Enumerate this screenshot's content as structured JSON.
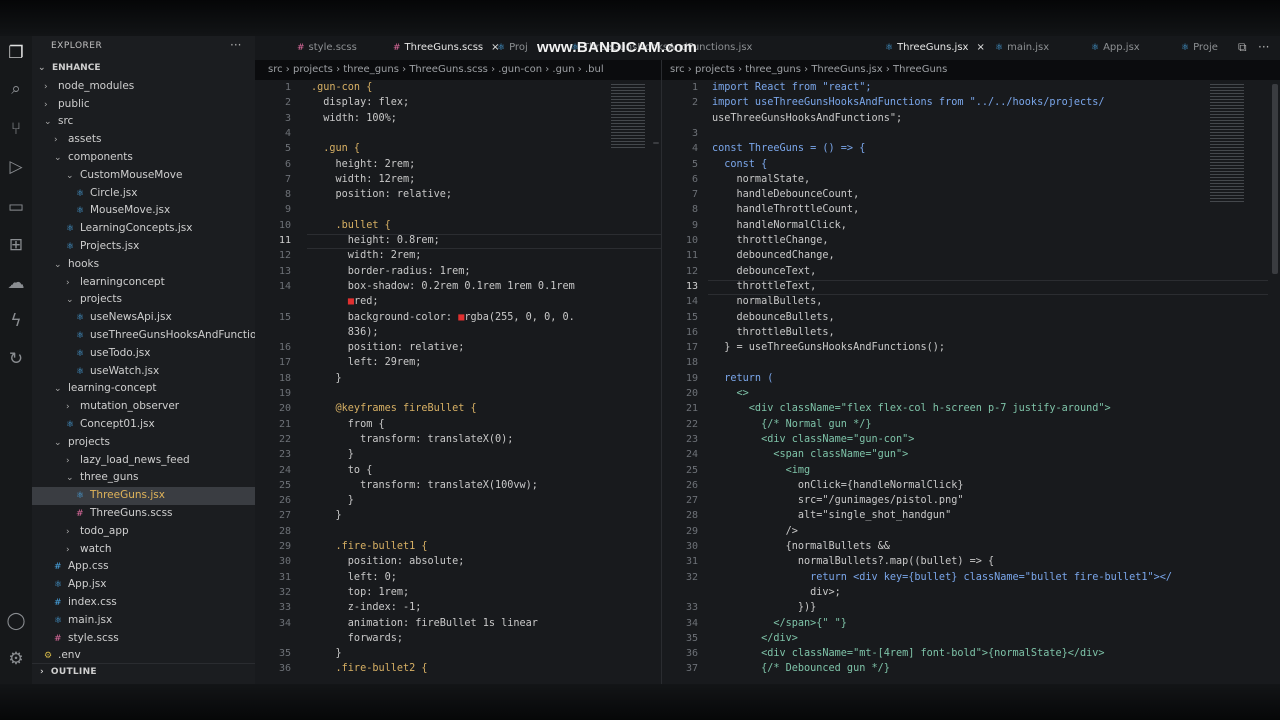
{
  "watermark": "www.BANDICAM.com",
  "activity_icons": [
    "files-icon",
    "search-icon",
    "source-control-icon",
    "run-debug-icon",
    "remote-explorer-icon",
    "extensions-icon",
    "docker-icon",
    "thunder-icon",
    "live-share-icon",
    "account-icon",
    "settings-gear-icon"
  ],
  "sidebar": {
    "title": "EXPLORER",
    "more": "···",
    "outline": "OUTLINE",
    "items": [
      {
        "label": "ENHANCE",
        "depth": 0,
        "type": "root",
        "chev": "v"
      },
      {
        "label": "node_modules",
        "depth": 1,
        "type": "folder",
        "chev": ">"
      },
      {
        "label": "public",
        "depth": 1,
        "type": "folder",
        "chev": ">"
      },
      {
        "label": "src",
        "depth": 1,
        "type": "folder",
        "chev": "v"
      },
      {
        "label": "assets",
        "depth": 2,
        "type": "folder",
        "chev": ">"
      },
      {
        "label": "components",
        "depth": 2,
        "type": "folder",
        "chev": "v"
      },
      {
        "label": "CustomMouseMove",
        "depth": 3,
        "type": "folder",
        "chev": "v"
      },
      {
        "label": "Circle.jsx",
        "depth": 4,
        "type": "js"
      },
      {
        "label": "MouseMove.jsx",
        "depth": 4,
        "type": "js"
      },
      {
        "label": "LearningConcepts.jsx",
        "depth": 3,
        "type": "js"
      },
      {
        "label": "Projects.jsx",
        "depth": 3,
        "type": "js"
      },
      {
        "label": "hooks",
        "depth": 2,
        "type": "folder",
        "chev": "v"
      },
      {
        "label": "learningconcept",
        "depth": 3,
        "type": "folder",
        "chev": ">"
      },
      {
        "label": "projects",
        "depth": 3,
        "type": "folder",
        "chev": "v"
      },
      {
        "label": "useNewsApi.jsx",
        "depth": 4,
        "type": "js"
      },
      {
        "label": "useThreeGunsHooksAndFunctions.jsx",
        "depth": 4,
        "type": "js"
      },
      {
        "label": "useTodo.jsx",
        "depth": 4,
        "type": "js"
      },
      {
        "label": "useWatch.jsx",
        "depth": 4,
        "type": "js"
      },
      {
        "label": "learning-concept",
        "depth": 2,
        "type": "folder",
        "chev": "v"
      },
      {
        "label": "mutation_observer",
        "depth": 3,
        "type": "folder",
        "chev": ">"
      },
      {
        "label": "Concept01.jsx",
        "depth": 3,
        "type": "js"
      },
      {
        "label": "projects",
        "depth": 2,
        "type": "folder",
        "chev": "v"
      },
      {
        "label": "lazy_load_news_feed",
        "depth": 3,
        "type": "folder",
        "chev": ">"
      },
      {
        "label": "three_guns",
        "depth": 3,
        "type": "folder",
        "chev": "v"
      },
      {
        "label": "ThreeGuns.jsx",
        "depth": 4,
        "type": "js",
        "selected": true
      },
      {
        "label": "ThreeGuns.scss",
        "depth": 4,
        "type": "scss"
      },
      {
        "label": "todo_app",
        "depth": 3,
        "type": "folder",
        "chev": ">"
      },
      {
        "label": "watch",
        "depth": 3,
        "type": "folder",
        "chev": ">"
      },
      {
        "label": "App.css",
        "depth": 2,
        "type": "css"
      },
      {
        "label": "App.jsx",
        "depth": 2,
        "type": "js"
      },
      {
        "label": "index.css",
        "depth": 2,
        "type": "css"
      },
      {
        "label": "main.jsx",
        "depth": 2,
        "type": "js"
      },
      {
        "label": "style.scss",
        "depth": 2,
        "type": "scss"
      },
      {
        "label": ".env",
        "depth": 1,
        "type": "env"
      }
    ]
  },
  "tabs": [
    {
      "label": "style.scss",
      "type": "scss",
      "active": false
    },
    {
      "label": "ThreeGuns.scss",
      "type": "scss",
      "active": true,
      "close": "×"
    },
    {
      "label": "Proj",
      "type": "js",
      "active": false
    },
    {
      "label": "ThreeGunsHooksAndFunctions.jsx",
      "type": "js",
      "active": false
    },
    {
      "label": "ThreeGuns.jsx",
      "type": "js",
      "active": true,
      "close": "×"
    },
    {
      "label": "main.jsx",
      "type": "js",
      "active": false
    },
    {
      "label": "App.jsx",
      "type": "js",
      "active": false
    },
    {
      "label": "Proje",
      "type": "js",
      "active": false
    }
  ],
  "left_breadcrumb": [
    "src",
    "projects",
    "three_guns",
    "ThreeGuns.scss",
    ".gun-con",
    ".gun",
    ".bul"
  ],
  "right_breadcrumb": [
    "src",
    "projects",
    "three_guns",
    "ThreeGuns.jsx",
    "ThreeGuns"
  ],
  "left_code": [
    {
      "n": "1",
      "t": ".gun-con {"
    },
    {
      "n": "2",
      "t": "  display: flex;"
    },
    {
      "n": "3",
      "t": "  width: 100%;"
    },
    {
      "n": "4",
      "t": ""
    },
    {
      "n": "5",
      "t": "  .gun {"
    },
    {
      "n": "6",
      "t": "    height: 2rem;"
    },
    {
      "n": "7",
      "t": "    width: 12rem;"
    },
    {
      "n": "8",
      "t": "    position: relative;"
    },
    {
      "n": "9",
      "t": ""
    },
    {
      "n": "10",
      "t": "    .bullet {"
    },
    {
      "n": "11",
      "t": "      height: 0.8rem;",
      "cur": true
    },
    {
      "n": "12",
      "t": "      width: 2rem;"
    },
    {
      "n": "13",
      "t": "      border-radius: 1rem;"
    },
    {
      "n": "14",
      "t": "      box-shadow: 0.2rem 0.1rem 1rem 0.1rem"
    },
    {
      "n": "",
      "t": "      ■red;"
    },
    {
      "n": "15",
      "t": "      background-color: ■rgba(255, 0, 0, 0."
    },
    {
      "n": "",
      "t": "      836);"
    },
    {
      "n": "16",
      "t": "      position: relative;"
    },
    {
      "n": "17",
      "t": "      left: 29rem;"
    },
    {
      "n": "18",
      "t": "    }"
    },
    {
      "n": "19",
      "t": ""
    },
    {
      "n": "20",
      "t": "    @keyframes fireBullet {"
    },
    {
      "n": "21",
      "t": "      from {"
    },
    {
      "n": "22",
      "t": "        transform: translateX(0);"
    },
    {
      "n": "23",
      "t": "      }"
    },
    {
      "n": "24",
      "t": "      to {"
    },
    {
      "n": "25",
      "t": "        transform: translateX(100vw);"
    },
    {
      "n": "26",
      "t": "      }"
    },
    {
      "n": "27",
      "t": "    }"
    },
    {
      "n": "28",
      "t": ""
    },
    {
      "n": "29",
      "t": "    .fire-bullet1 {"
    },
    {
      "n": "30",
      "t": "      position: absolute;"
    },
    {
      "n": "31",
      "t": "      left: 0;"
    },
    {
      "n": "32",
      "t": "      top: 1rem;"
    },
    {
      "n": "33",
      "t": "      z-index: -1;"
    },
    {
      "n": "34",
      "t": "      animation: fireBullet 1s linear"
    },
    {
      "n": "",
      "t": "      forwards;"
    },
    {
      "n": "35",
      "t": "    }"
    },
    {
      "n": "36",
      "t": "    .fire-bullet2 {"
    }
  ],
  "right_code": [
    {
      "n": "1",
      "t": "import React from \"react\";"
    },
    {
      "n": "2",
      "t": "import useThreeGunsHooksAndFunctions from \"../../hooks/projects/"
    },
    {
      "n": "",
      "t": "useThreeGunsHooksAndFunctions\";"
    },
    {
      "n": "3",
      "t": ""
    },
    {
      "n": "4",
      "t": "const ThreeGuns = () => {"
    },
    {
      "n": "5",
      "t": "  const {"
    },
    {
      "n": "6",
      "t": "    normalState,"
    },
    {
      "n": "7",
      "t": "    handleDebounceCount,"
    },
    {
      "n": "8",
      "t": "    handleThrottleCount,"
    },
    {
      "n": "9",
      "t": "    handleNormalClick,"
    },
    {
      "n": "10",
      "t": "    throttleChange,"
    },
    {
      "n": "11",
      "t": "    debouncedChange,"
    },
    {
      "n": "12",
      "t": "    debounceText,"
    },
    {
      "n": "13",
      "t": "    throttleText,",
      "cur": true
    },
    {
      "n": "14",
      "t": "    normalBullets,"
    },
    {
      "n": "15",
      "t": "    debounceBullets,"
    },
    {
      "n": "16",
      "t": "    throttleBullets,"
    },
    {
      "n": "17",
      "t": "  } = useThreeGunsHooksAndFunctions();"
    },
    {
      "n": "18",
      "t": ""
    },
    {
      "n": "19",
      "t": "  return ("
    },
    {
      "n": "20",
      "t": "    <>"
    },
    {
      "n": "21",
      "t": "      <div className=\"flex flex-col h-screen p-7 justify-around\">"
    },
    {
      "n": "22",
      "t": "        {/* Normal gun */}"
    },
    {
      "n": "23",
      "t": "        <div className=\"gun-con\">"
    },
    {
      "n": "24",
      "t": "          <span className=\"gun\">"
    },
    {
      "n": "25",
      "t": "            <img"
    },
    {
      "n": "26",
      "t": "              onClick={handleNormalClick}"
    },
    {
      "n": "27",
      "t": "              src=\"/gunimages/pistol.png\""
    },
    {
      "n": "28",
      "t": "              alt=\"single_shot_handgun\""
    },
    {
      "n": "29",
      "t": "            />"
    },
    {
      "n": "30",
      "t": "            {normalBullets &&"
    },
    {
      "n": "31",
      "t": "              normalBullets?.map((bullet) => {"
    },
    {
      "n": "32",
      "t": "                return <div key={bullet} className=\"bullet fire-bullet1\"></"
    },
    {
      "n": "",
      "t": "                div>;"
    },
    {
      "n": "33",
      "t": "              })}"
    },
    {
      "n": "34",
      "t": "          </span>{\" \"}"
    },
    {
      "n": "35",
      "t": "        </div>"
    },
    {
      "n": "36",
      "t": "        <div className=\"mt-[4rem] font-bold\">{normalState}</div>"
    },
    {
      "n": "37",
      "t": "        {/* Debounced gun */}"
    }
  ]
}
